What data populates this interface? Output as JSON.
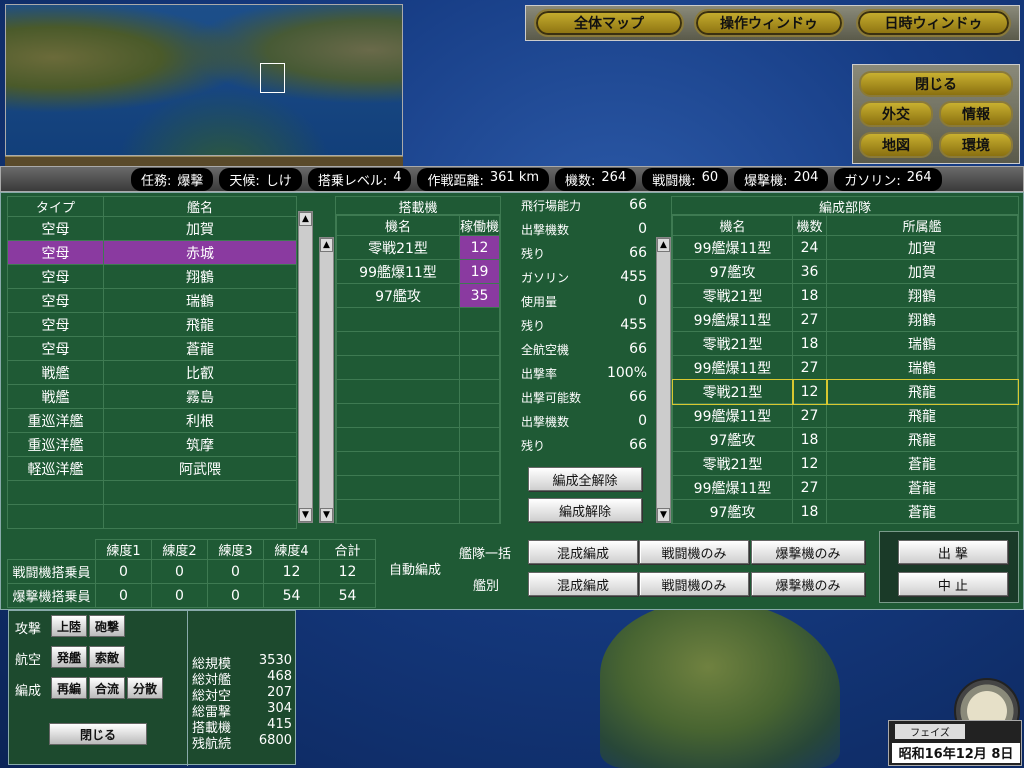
{
  "top_buttons": [
    "全体マップ",
    "操作ウィンドゥ",
    "日時ウィンドゥ"
  ],
  "side_buttons": [
    "閉じる",
    "外交",
    "情報",
    "地図",
    "環境"
  ],
  "status": [
    {
      "label": "任務:",
      "value": "爆撃"
    },
    {
      "label": "天候:",
      "value": "しけ"
    },
    {
      "label": "搭乗レベル:",
      "value": "4"
    },
    {
      "label": "作戦距離:",
      "value": "361 km"
    },
    {
      "label": "機数:",
      "value": "264"
    },
    {
      "label": "戦闘機:",
      "value": "60"
    },
    {
      "label": "爆撃機:",
      "value": "204"
    },
    {
      "label": "ガソリン:",
      "value": "264"
    }
  ],
  "ships": {
    "headers": [
      "タイプ",
      "艦名"
    ],
    "rows": [
      [
        "空母",
        "加賀"
      ],
      [
        "空母",
        "赤城"
      ],
      [
        "空母",
        "翔鶴"
      ],
      [
        "空母",
        "瑞鶴"
      ],
      [
        "空母",
        "飛龍"
      ],
      [
        "空母",
        "蒼龍"
      ],
      [
        "戦艦",
        "比叡"
      ],
      [
        "戦艦",
        "霧島"
      ],
      [
        "重巡洋艦",
        "利根"
      ],
      [
        "重巡洋艦",
        "筑摩"
      ],
      [
        "軽巡洋艦",
        "阿武隈"
      ]
    ],
    "selected_index": 1
  },
  "aircraft": {
    "title": "搭載機",
    "headers": [
      "機名",
      "稼働機"
    ],
    "rows": [
      [
        "零戦21型",
        "12"
      ],
      [
        "99艦爆11型",
        "19"
      ],
      [
        "97艦攻",
        "35"
      ]
    ]
  },
  "stats": [
    {
      "label": "飛行場能力",
      "value": "66"
    },
    {
      "label": "出撃機数",
      "value": "0"
    },
    {
      "label": "残り",
      "value": "66"
    },
    {
      "label": "ガソリン",
      "value": "455"
    },
    {
      "label": "使用量",
      "value": "0"
    },
    {
      "label": "残り",
      "value": "455"
    },
    {
      "label": "全航空機",
      "value": "66"
    },
    {
      "label": "出撃率",
      "value": "100%"
    },
    {
      "label": "出撃可能数",
      "value": "66"
    },
    {
      "label": "出撃機数",
      "value": "0"
    },
    {
      "label": "残り",
      "value": "66"
    }
  ],
  "unit_buttons": [
    "編成全解除",
    "編成解除"
  ],
  "formation": {
    "title": "編成部隊",
    "headers": [
      "機名",
      "機数",
      "所属艦"
    ],
    "rows": [
      [
        "99艦爆11型",
        "24",
        "加賀"
      ],
      [
        "97艦攻",
        "36",
        "加賀"
      ],
      [
        "零戦21型",
        "18",
        "翔鶴"
      ],
      [
        "99艦爆11型",
        "27",
        "翔鶴"
      ],
      [
        "零戦21型",
        "18",
        "瑞鶴"
      ],
      [
        "99艦爆11型",
        "27",
        "瑞鶴"
      ],
      [
        "零戦21型",
        "12",
        "飛龍"
      ],
      [
        "99艦爆11型",
        "27",
        "飛龍"
      ],
      [
        "97艦攻",
        "18",
        "飛龍"
      ],
      [
        "零戦21型",
        "12",
        "蒼龍"
      ],
      [
        "99艦爆11型",
        "27",
        "蒼龍"
      ],
      [
        "97艦攻",
        "18",
        "蒼龍"
      ]
    ],
    "highlighted_index": 6
  },
  "crew": {
    "headers": [
      "練度1",
      "練度2",
      "練度3",
      "練度4",
      "合計"
    ],
    "rows": [
      {
        "label": "戦闘機搭乗員",
        "values": [
          "0",
          "0",
          "0",
          "12",
          "12"
        ]
      },
      {
        "label": "爆撃機搭乗員",
        "values": [
          "0",
          "0",
          "0",
          "54",
          "54"
        ]
      }
    ]
  },
  "auto": {
    "label": "自動編成",
    "rows": [
      {
        "label": "艦隊一括",
        "buttons": [
          "混成編成",
          "戦闘機のみ",
          "爆撃機のみ"
        ]
      },
      {
        "label": "艦別",
        "buttons": [
          "混成編成",
          "戦闘機のみ",
          "爆撃機のみ"
        ]
      }
    ]
  },
  "actions": [
    "出 撃",
    "中 止"
  ],
  "commands": [
    {
      "label": "攻撃",
      "buttons": [
        "上陸",
        "砲撃"
      ]
    },
    {
      "label": "航空",
      "buttons": [
        "発艦",
        "索敵"
      ]
    },
    {
      "label": "編成",
      "buttons": [
        "再編",
        "合流",
        "分散"
      ]
    }
  ],
  "close_label": "閉じる",
  "totals": [
    {
      "label": "総規模",
      "value": "3530"
    },
    {
      "label": "総対艦",
      "value": "468"
    },
    {
      "label": "総対空",
      "value": "207"
    },
    {
      "label": "総雷撃",
      "value": "304"
    },
    {
      "label": "搭載機",
      "value": "415"
    },
    {
      "label": "残航続",
      "value": "6800"
    }
  ],
  "phase": "フェイズ",
  "date": "昭和16年12月 8日",
  "colors": {
    "selected": "#8a3aa0",
    "panel": "#1f5a35",
    "gold": "#c8b030"
  }
}
